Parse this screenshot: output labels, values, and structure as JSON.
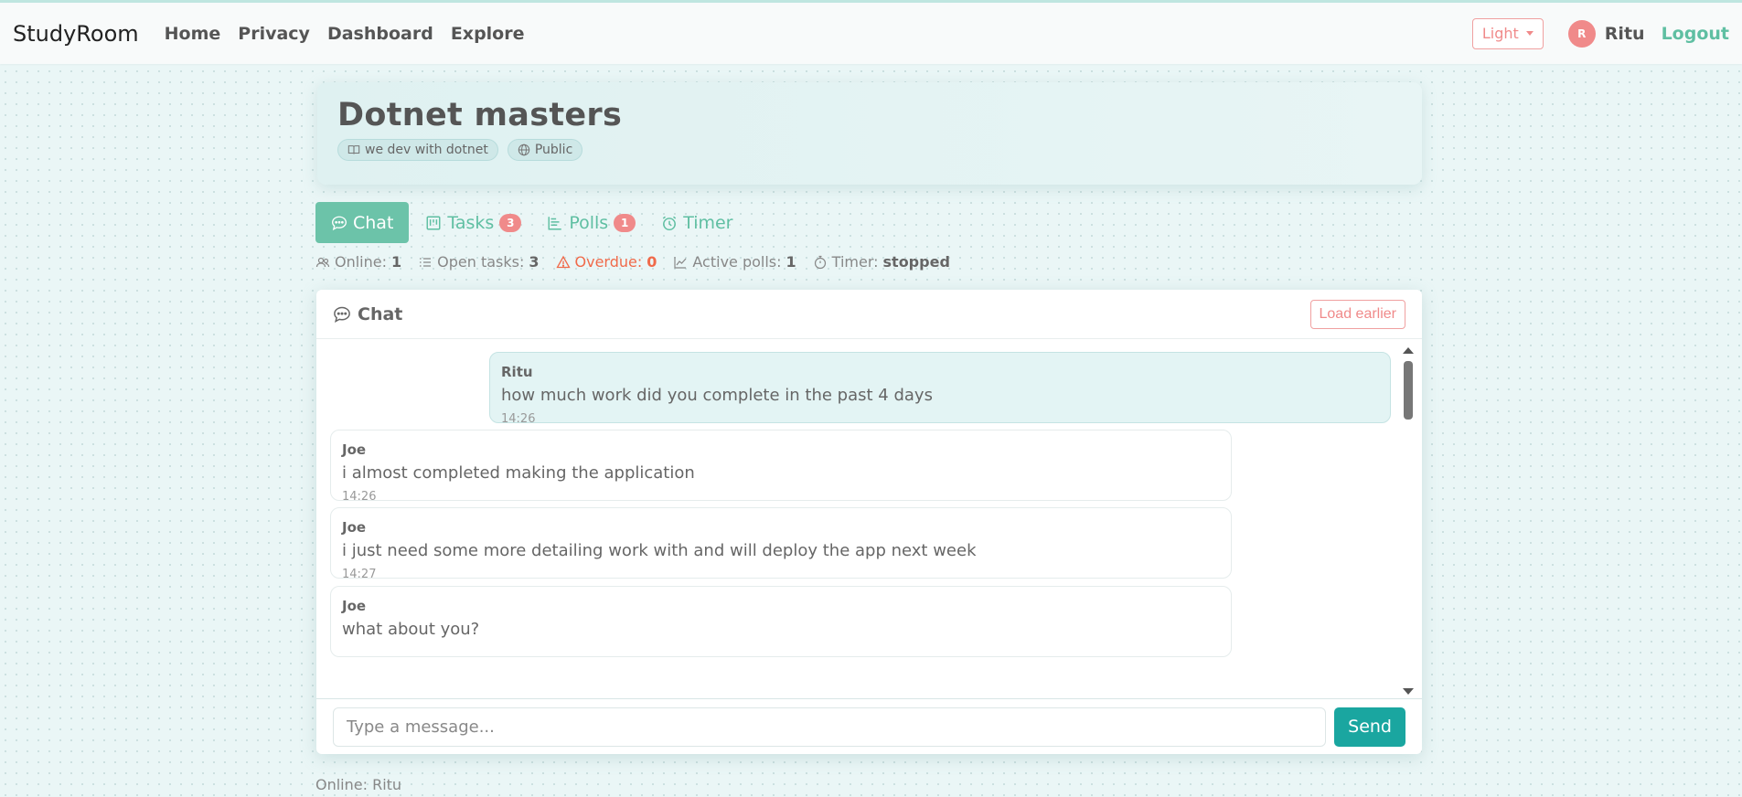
{
  "navbar": {
    "brand": "StudyRoom",
    "links": [
      "Home",
      "Privacy",
      "Dashboard",
      "Explore"
    ],
    "theme_label": "Light",
    "avatar_initial": "R",
    "username": "Ritu",
    "logout_label": "Logout"
  },
  "room": {
    "title": "Dotnet masters",
    "subject": "we dev with dotnet",
    "visibility": "Public"
  },
  "tabs": [
    {
      "label": "Chat",
      "icon": "chat-icon",
      "badge": null
    },
    {
      "label": "Tasks",
      "icon": "kanban-icon",
      "badge": "3"
    },
    {
      "label": "Polls",
      "icon": "poll-icon",
      "badge": "1"
    },
    {
      "label": "Timer",
      "icon": "alarm-icon",
      "badge": null
    }
  ],
  "stats": {
    "online_label": "Online:",
    "online_value": "1",
    "open_tasks_label": "Open tasks:",
    "open_tasks_value": "3",
    "overdue_label": "Overdue:",
    "overdue_value": "0",
    "active_polls_label": "Active polls:",
    "active_polls_value": "1",
    "timer_label": "Timer:",
    "timer_value": "stopped"
  },
  "chat": {
    "title": "Chat",
    "load_earlier_label": "Load earlier",
    "messages": [
      {
        "author": "Ritu",
        "text": "how much work did you complete in the past 4 days",
        "time": "14:26",
        "mine": true
      },
      {
        "author": "Joe",
        "text": "i almost completed making the application",
        "time": "14:26",
        "mine": false
      },
      {
        "author": "Joe",
        "text": "i just need some more detailing work with and will deploy the app next week",
        "time": "14:27",
        "mine": false
      },
      {
        "author": "Joe",
        "text": "what about you?",
        "time": "",
        "mine": false
      }
    ],
    "input_placeholder": "Type a message...",
    "send_label": "Send"
  },
  "footer": {
    "online_text": "Online: Ritu"
  },
  "colors": {
    "accent": "#6cc3a9",
    "danger": "#f08a8a",
    "send": "#1aa6a0"
  }
}
